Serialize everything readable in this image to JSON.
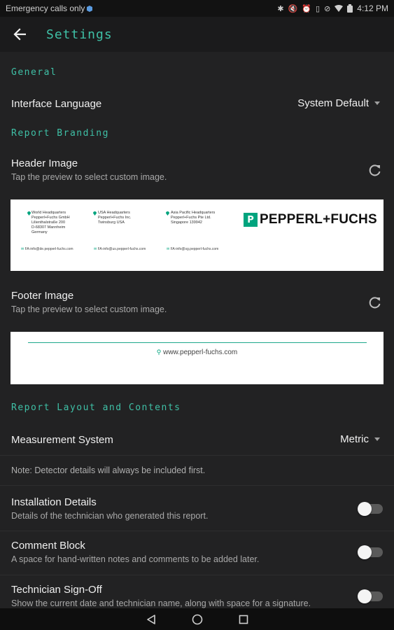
{
  "status_bar": {
    "left_text": "Emergency calls only",
    "time": "4:12 PM"
  },
  "app_bar": {
    "back_icon": "arrow-back-icon",
    "title": "Settings"
  },
  "sections": {
    "general": "General",
    "branding": "Report Branding",
    "layout": "Report Layout and Contents"
  },
  "interface_language": {
    "label": "Interface Language",
    "value": "System Default"
  },
  "header_image": {
    "title": "Header Image",
    "subtitle": "Tap the preview to select custom image.",
    "preview": {
      "hq1": [
        "World Headquarters",
        "Pepperl+Fuchs GmbH",
        "Lilienthalstraße 200",
        "D-68307 Mannheim",
        "Germany"
      ],
      "hq2": [
        "USA Headquarters",
        "Pepperl+Fuchs Inc.",
        "Twinsburg USA"
      ],
      "hq3": [
        "Asia Pacific Headquarters",
        "Pepperl+Fuchs Pte Ltd.",
        "Singapore 139942"
      ],
      "mail1": "FA-info@de.pepperl-fuchs.com",
      "mail2": "FA-info@us.pepperl-fuchs.com",
      "mail3": "FA-info@sg.pepperl-fuchs.com",
      "logo_mark": "P",
      "logo_text": "PEPPERL+FUCHS"
    }
  },
  "footer_image": {
    "title": "Footer Image",
    "subtitle": "Tap the preview to select custom image.",
    "preview": {
      "url": "www.pepperl-fuchs.com"
    }
  },
  "measurement_system": {
    "label": "Measurement System",
    "value": "Metric"
  },
  "note": "Note: Detector details will always be included first.",
  "toggles": [
    {
      "title": "Installation Details",
      "subtitle": "Details of the technician who generated this report.",
      "enabled": false
    },
    {
      "title": "Comment Block",
      "subtitle": "A space for hand-written notes and comments to be added later.",
      "enabled": false
    },
    {
      "title": "Technician Sign-Off",
      "subtitle": "Show the current date and technician name, along with space for a signature.",
      "enabled": false
    }
  ],
  "colors": {
    "accent": "#3fc0a6",
    "background": "#222223",
    "app_bar": "#1b1b1c",
    "brand_green": "#00a47e"
  },
  "nav_bar": {
    "back": "triangle-back-icon",
    "home": "circle-home-icon",
    "recents": "square-recents-icon"
  }
}
